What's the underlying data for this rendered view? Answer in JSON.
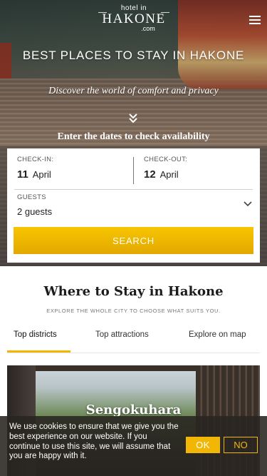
{
  "header": {
    "logo_small": "hotel in",
    "logo_big": "HAKONE",
    "logo_domain": ".com",
    "menu_icon": "hamburger-icon"
  },
  "hero": {
    "title": "BEST PLACES TO STAY IN HAKONE",
    "subtitle": "Discover the world of comfort and privacy",
    "scroll_icon": "double-chevron-down-icon",
    "dates_prompt": "Enter the dates to check availability"
  },
  "booking": {
    "checkin_label": "CHECK-IN:",
    "checkin_day": "11",
    "checkin_month": "April",
    "checkout_label": "CHECK-OUT:",
    "checkout_day": "12",
    "checkout_month": "April",
    "guests_label": "GUESTS",
    "guests_value": "2 guests",
    "guests_icon": "chevron-down-icon",
    "search_label": "SEARCH"
  },
  "main": {
    "title": "Where to Stay in Hakone",
    "subtitle": "EXPLORE THE WHOLE CITY TO CHOOSE WHAT SUITS YOU.",
    "tabs": [
      {
        "label": "Top districts",
        "active": true
      },
      {
        "label": "Top attractions",
        "active": false
      },
      {
        "label": "Explore on map",
        "active": false
      }
    ],
    "district_card": {
      "name": "Sengokuhara"
    }
  },
  "cookie": {
    "text": "We use cookies to ensure that we give you the best experience on our website. If you continue to use this site, we will assume that you are happy with it.",
    "ok_label": "OK",
    "no_label": "NO"
  },
  "colors": {
    "accent": "#f2b705",
    "search_button": "#f0b800",
    "cookie_bg": "#2a2420"
  }
}
